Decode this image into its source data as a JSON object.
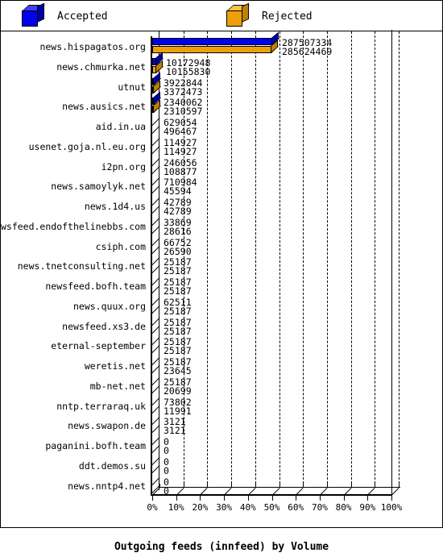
{
  "legend": {
    "accepted_label": "Accepted",
    "rejected_label": "Rejected",
    "accepted_color": "#0000ee",
    "rejected_color": "#eda009"
  },
  "axis": {
    "title": "Outgoing feeds (innfeed) by Volume",
    "xticks": [
      "0%",
      "10%",
      "20%",
      "30%",
      "40%",
      "50%",
      "60%",
      "70%",
      "80%",
      "90%",
      "100%"
    ]
  },
  "chart_data": {
    "type": "bar",
    "title": "Outgoing feeds (innfeed) by Volume",
    "xlabel": "Outgoing feeds (innfeed) by Volume",
    "ylabel": "",
    "orientation": "horizontal",
    "grid": true,
    "legend_position": "top",
    "xlim": [
      0,
      100
    ],
    "xtick_labels": [
      "0%",
      "10%",
      "20%",
      "30%",
      "40%",
      "50%",
      "60%",
      "70%",
      "80%",
      "90%",
      "100%"
    ],
    "xtick_values": [
      0,
      10,
      20,
      30,
      40,
      50,
      60,
      70,
      80,
      90,
      100
    ],
    "categories": [
      "news.hispagatos.org",
      "news.chmurka.net",
      "utnut",
      "news.ausics.net",
      "aid.in.ua",
      "usenet.goja.nl.eu.org",
      "i2pn.org",
      "news.samoylyk.net",
      "news.1d4.us",
      "newsfeed.endofthelinebbs.com",
      "csiph.com",
      "news.tnetconsulting.net",
      "newsfeed.bofh.team",
      "news.quux.org",
      "newsfeed.xs3.de",
      "eternal-september",
      "weretis.net",
      "mb-net.net",
      "nntp.terraraq.uk",
      "news.swapon.de",
      "paganini.bofh.team",
      "ddt.demos.su",
      "news.nntp4.net"
    ],
    "series": [
      {
        "name": "Accepted",
        "color": "#0000ee",
        "values": [
          287507334,
          10172948,
          3922844,
          2340062,
          629054,
          114927,
          246056,
          710984,
          42789,
          33869,
          66752,
          25187,
          25187,
          62511,
          25187,
          25187,
          25187,
          25187,
          73802,
          3121,
          0,
          0,
          0
        ]
      },
      {
        "name": "Rejected",
        "color": "#eda009",
        "values": [
          285624469,
          10155830,
          3372473,
          2310597,
          496467,
          114927,
          108877,
          45594,
          42789,
          28616,
          26590,
          25187,
          25187,
          25187,
          25187,
          25187,
          23645,
          20699,
          11991,
          3121,
          0,
          0,
          0
        ]
      }
    ]
  }
}
